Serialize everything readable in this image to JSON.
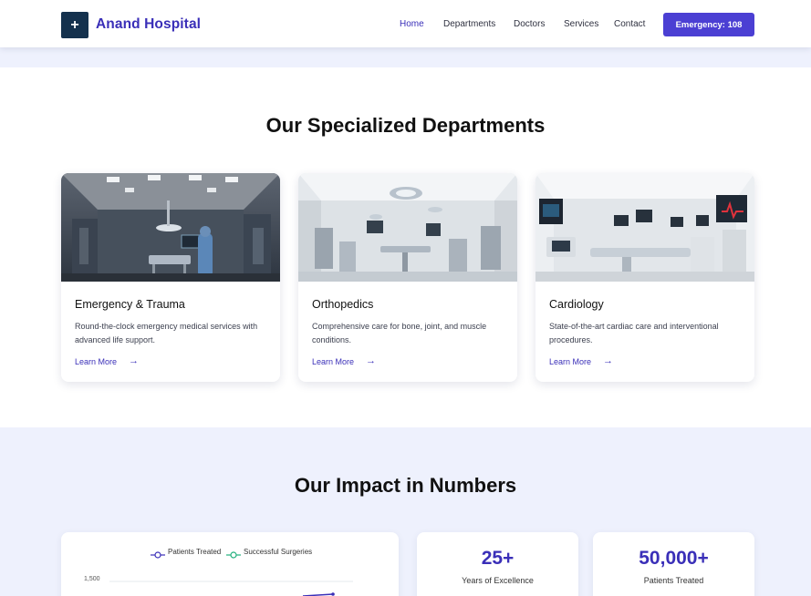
{
  "header": {
    "brand": "Anand Hospital",
    "logo_icon": "+",
    "nav": [
      "Home",
      "Departments",
      "Doctors",
      "Services",
      "Contact"
    ],
    "active_nav": "Home",
    "emergency_label": "Emergency: 108"
  },
  "departments": {
    "title": "Our Specialized Departments",
    "cards": [
      {
        "title": "Emergency & Trauma",
        "description": "Round-the-clock emergency medical services with advanced life support.",
        "link": "Learn More"
      },
      {
        "title": "Orthopedics",
        "description": "Comprehensive care for bone, joint, and muscle conditions.",
        "link": "Learn More"
      },
      {
        "title": "Cardiology",
        "description": "State-of-the-art cardiac care and interventional procedures.",
        "link": "Learn More"
      }
    ]
  },
  "impact": {
    "title": "Our Impact in Numbers",
    "stats": [
      {
        "value": "25+",
        "label": "Years of Excellence"
      },
      {
        "value": "50,000+",
        "label": "Patients Treated"
      }
    ]
  },
  "chart_data": {
    "type": "line",
    "series": [
      {
        "name": "Patients Treated",
        "color": "#3a2fb8"
      },
      {
        "name": "Successful Surgeries",
        "color": "#22b07d"
      }
    ],
    "y_ticks": [
      "1,500"
    ]
  },
  "colors": {
    "accent": "#3a2fb8",
    "button": "#4b3fd3",
    "navy": "#14314d"
  }
}
